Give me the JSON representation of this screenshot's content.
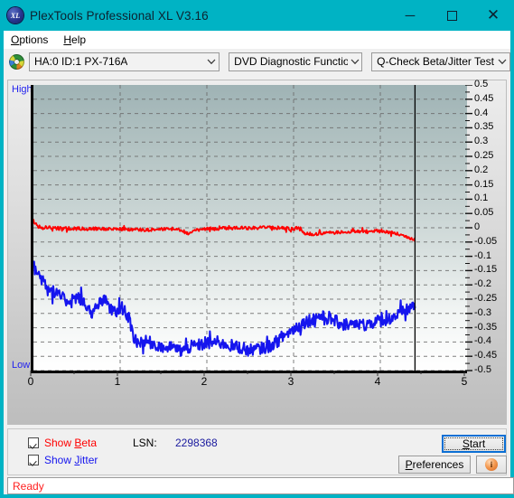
{
  "window": {
    "title": "PlexTools Professional XL V3.16",
    "app_icon": "xl-logo-icon",
    "minimize_label": "─",
    "maximize_label": "□",
    "close_label": "✕"
  },
  "menubar": {
    "items": [
      {
        "label": "Options",
        "accelerator": "O"
      },
      {
        "label": "Help",
        "accelerator": "H"
      }
    ]
  },
  "toolbar": {
    "drive_icon": "disc-icon",
    "drive_combo": {
      "value": "HA:0 ID:1  PX-716A",
      "arrow": "⌄"
    },
    "function_combo": {
      "value": "DVD Diagnostic Functions",
      "arrow": "⌄"
    },
    "test_combo": {
      "value": "Q-Check Beta/Jitter Test",
      "arrow": "⌄"
    }
  },
  "graph": {
    "high_label": "High",
    "low_label": "Low"
  },
  "controls": {
    "show_beta": {
      "label_pre": "Show ",
      "label_acc": "B",
      "label_post": "eta",
      "checked": true,
      "color": "#ff0000"
    },
    "show_jitter": {
      "label_pre": "Show ",
      "label_acc": "J",
      "label_post": "itter",
      "checked": true,
      "color": "#1515ee"
    },
    "lsn_label": "LSN:",
    "lsn_value": "2298368",
    "start_button": {
      "pre": "",
      "acc": "S",
      "post": "tart"
    },
    "preferences_button": {
      "pre": "",
      "acc": "P",
      "post": "references"
    },
    "info_button": "i"
  },
  "statusbar": {
    "text": "Ready"
  },
  "chart_data": {
    "type": "line",
    "title": "Q-Check Beta/Jitter Test",
    "xlabel": "",
    "ylabel": "",
    "xlim": [
      0,
      5
    ],
    "ylim": [
      -0.5,
      0.5
    ],
    "grid": true,
    "legend_position": "external-checkboxes",
    "x_ticks": [
      "0",
      "1",
      "2",
      "3",
      "4",
      "5"
    ],
    "y_ticks": [
      "0.5",
      "0.45",
      "0.4",
      "0.35",
      "0.3",
      "0.25",
      "0.2",
      "0.15",
      "0.1",
      "0.05",
      "0",
      "-0.05",
      "-0.1",
      "-0.15",
      "-0.2",
      "-0.25",
      "-0.3",
      "-0.35",
      "-0.4",
      "-0.45",
      "-0.5"
    ],
    "data_end_x": 4.4,
    "series": [
      {
        "name": "Show Beta",
        "color": "#ff0000",
        "x": [
          0.0,
          0.05,
          0.1,
          0.15,
          0.2,
          0.3,
          0.4,
          0.5,
          0.6,
          0.7,
          0.8,
          0.9,
          1.0,
          1.1,
          1.2,
          1.3,
          1.4,
          1.5,
          1.6,
          1.7,
          1.8,
          1.9,
          2.0,
          2.1,
          2.2,
          2.3,
          2.4,
          2.5,
          2.6,
          2.7,
          2.8,
          2.9,
          3.0,
          3.05,
          3.1,
          3.2,
          3.3,
          3.4,
          3.5,
          3.6,
          3.7,
          3.8,
          3.9,
          4.0,
          4.1,
          4.2,
          4.3,
          4.4
        ],
        "y": [
          0.02,
          0.005,
          0.002,
          0.0,
          0.0,
          -0.002,
          -0.002,
          -0.003,
          -0.003,
          -0.004,
          -0.003,
          -0.002,
          -0.004,
          -0.006,
          -0.006,
          -0.007,
          -0.006,
          -0.005,
          -0.004,
          -0.01,
          -0.02,
          -0.006,
          -0.004,
          -0.003,
          -0.002,
          -0.001,
          0.0,
          0.0,
          0.0,
          0.0,
          0.0,
          -0.002,
          -0.004,
          0.0,
          -0.014,
          -0.022,
          -0.02,
          -0.018,
          -0.016,
          -0.014,
          -0.013,
          -0.012,
          -0.012,
          -0.013,
          -0.016,
          -0.022,
          -0.03,
          -0.04
        ]
      },
      {
        "name": "Show Jitter",
        "color": "#1515ee",
        "x": [
          0.0,
          0.05,
          0.1,
          0.15,
          0.2,
          0.25,
          0.3,
          0.35,
          0.4,
          0.45,
          0.5,
          0.55,
          0.6,
          0.65,
          0.7,
          0.75,
          0.8,
          0.85,
          0.9,
          0.95,
          1.0,
          1.05,
          1.1,
          1.15,
          1.2,
          1.3,
          1.4,
          1.5,
          1.6,
          1.7,
          1.8,
          1.9,
          2.0,
          2.1,
          2.2,
          2.3,
          2.4,
          2.5,
          2.6,
          2.7,
          2.8,
          2.9,
          3.0,
          3.1,
          3.2,
          3.3,
          3.4,
          3.5,
          3.6,
          3.7,
          3.8,
          3.9,
          4.0,
          4.1,
          4.2,
          4.3,
          4.4
        ],
        "y": [
          -0.135,
          -0.16,
          -0.18,
          -0.2,
          -0.215,
          -0.23,
          -0.24,
          -0.25,
          -0.255,
          -0.248,
          -0.245,
          -0.25,
          -0.27,
          -0.29,
          -0.3,
          -0.27,
          -0.255,
          -0.262,
          -0.29,
          -0.3,
          -0.278,
          -0.285,
          -0.32,
          -0.38,
          -0.4,
          -0.4,
          -0.405,
          -0.42,
          -0.42,
          -0.43,
          -0.418,
          -0.412,
          -0.405,
          -0.4,
          -0.405,
          -0.415,
          -0.42,
          -0.43,
          -0.425,
          -0.418,
          -0.4,
          -0.375,
          -0.355,
          -0.335,
          -0.32,
          -0.31,
          -0.318,
          -0.33,
          -0.338,
          -0.342,
          -0.34,
          -0.332,
          -0.325,
          -0.318,
          -0.305,
          -0.29,
          -0.268
        ]
      }
    ]
  }
}
